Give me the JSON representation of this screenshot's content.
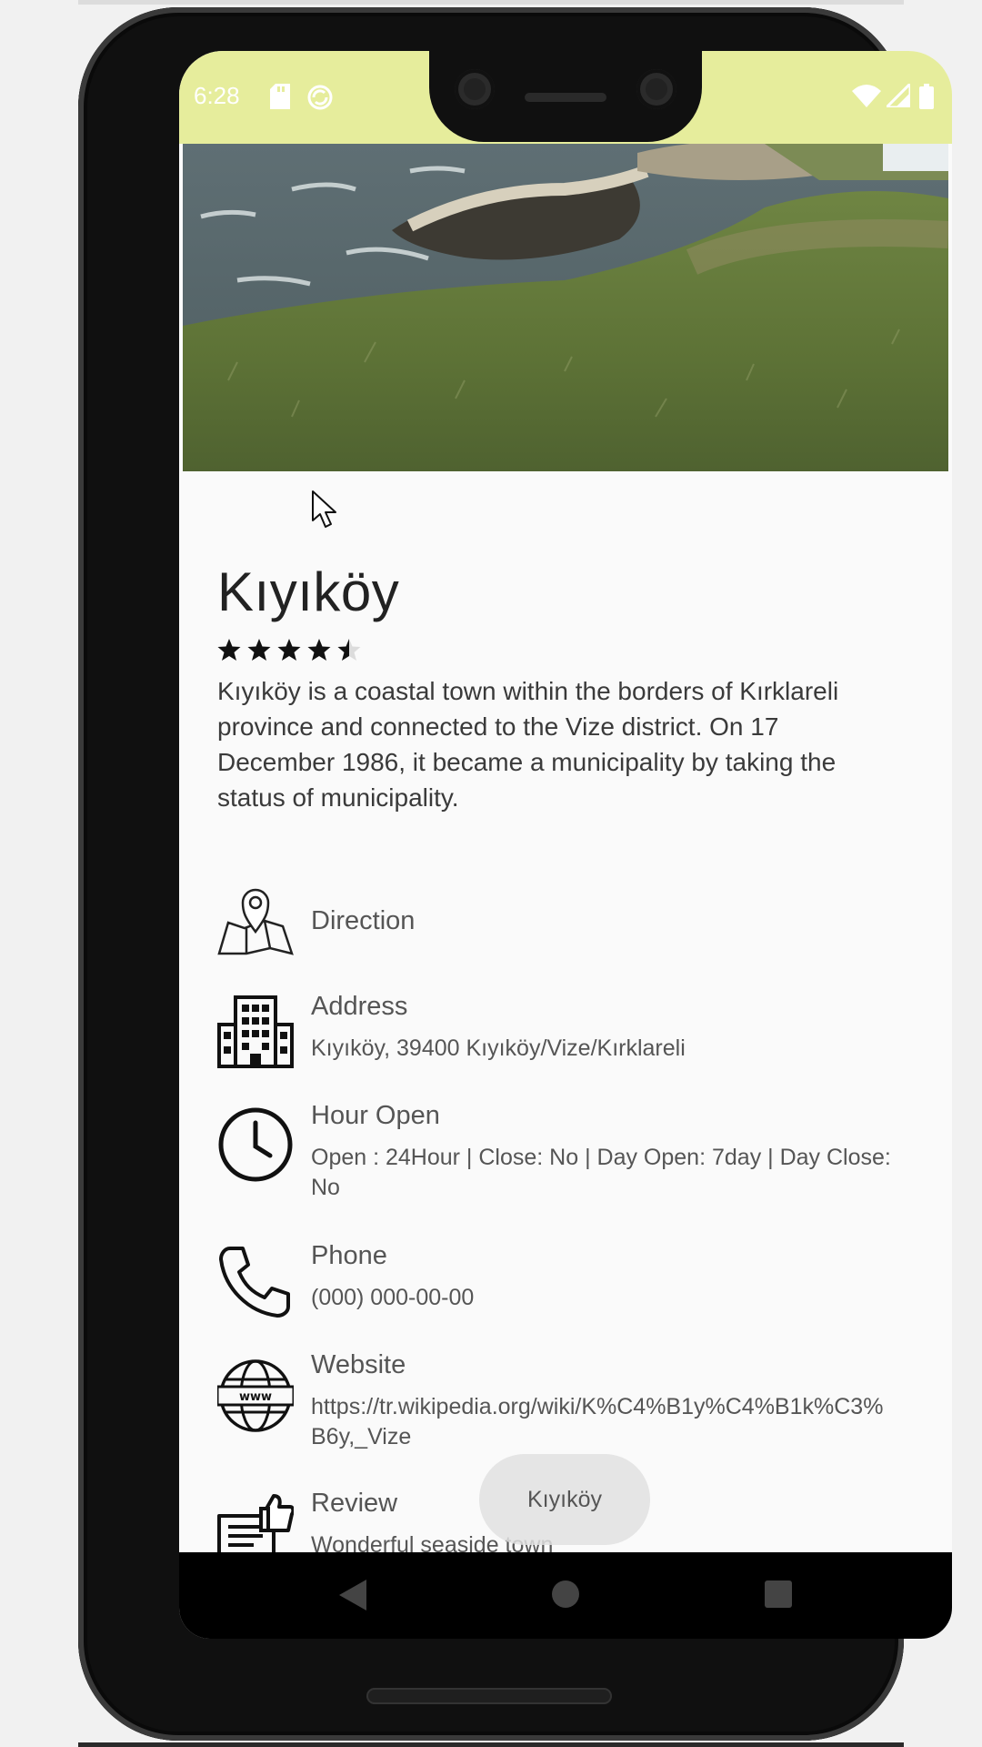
{
  "status_bar": {
    "time": "6:28",
    "left_icons": [
      "sd-card-icon",
      "sync-icon"
    ],
    "right_icons": [
      "wifi-icon",
      "signal-icon",
      "battery-icon"
    ],
    "color": "#e6ed9c"
  },
  "place": {
    "title": "Kıyıköy",
    "rating": 4.5,
    "rating_max": 5,
    "description": "Kıyıköy is a coastal town within the borders of Kırklareli province and connected to the Vize district. On 17 December 1986, it became a municipality by taking the status of municipality."
  },
  "info": {
    "direction": {
      "label": "Direction",
      "icon": "map-pin-icon"
    },
    "address": {
      "label": "Address",
      "value": "Kıyıköy, 39400 Kıyıköy/Vize/Kırklareli",
      "icon": "building-icon"
    },
    "hours": {
      "label": "Hour Open",
      "value": "Open : 24Hour | Close: No | Day Open: 7day | Day Close: No",
      "icon": "clock-icon"
    },
    "phone": {
      "label": "Phone",
      "value": "(000) 000-00-00",
      "icon": "phone-icon"
    },
    "website": {
      "label": "Website",
      "value": "https://tr.wikipedia.org/wiki/K%C4%B1y%C4%B1k%C3%B6y,_Vize",
      "icon": "globe-www-icon"
    },
    "review": {
      "label": "Review",
      "value": "Wonderful seaside town",
      "icon": "review-thumbs-up-icon"
    }
  },
  "toast": {
    "text": "Kıyıköy"
  },
  "nav_bar": {
    "buttons": [
      "back-icon",
      "home-icon",
      "recents-icon"
    ]
  }
}
